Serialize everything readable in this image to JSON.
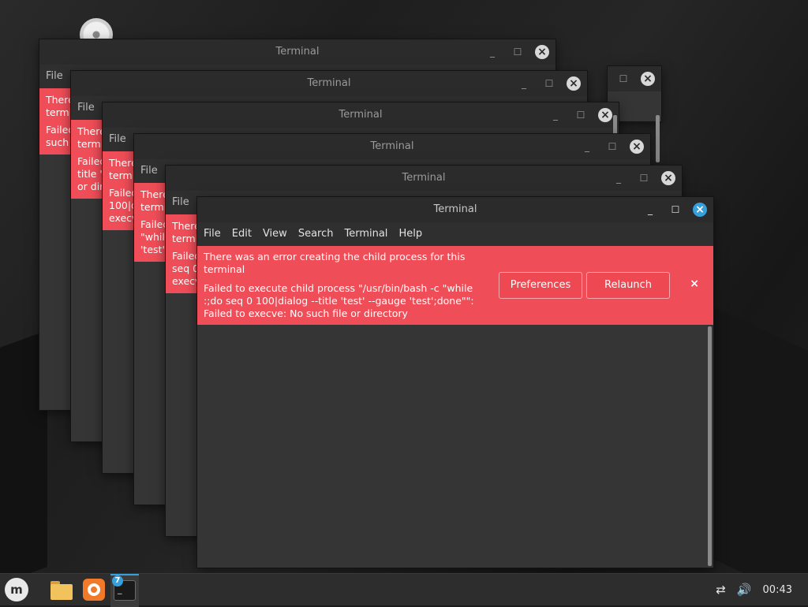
{
  "desktop": {
    "windows_back": [
      {
        "title": "Terminal",
        "menu_file": "File",
        "peek_lines": [
          "There",
          "termi",
          "Failed",
          "such"
        ]
      },
      {
        "title": "Terminal",
        "menu_file": "File",
        "peek_lines": [
          "There",
          "termi",
          "Failed",
          "title 't",
          "or dir"
        ]
      },
      {
        "title": "Terminal",
        "menu_file": "File",
        "peek_lines": [
          "There",
          "termi",
          "Failed",
          "100|d",
          "execve"
        ]
      },
      {
        "title": "Terminal",
        "menu_file": "File",
        "peek_lines": [
          "There",
          "termi",
          "Failed",
          "\"while",
          "'test';"
        ]
      },
      {
        "title": "Terminal",
        "menu_file": "File",
        "peek_lines": [
          "There",
          "termi",
          "Failed",
          "seq 0",
          "execv"
        ]
      }
    ],
    "active_window": {
      "title": "Terminal",
      "menu": [
        "File",
        "Edit",
        "View",
        "Search",
        "Terminal",
        "Help"
      ],
      "error": {
        "heading": "There was an error creating the child process for this terminal",
        "detail": "Failed to execute child process \"/usr/bin/bash -c \"while :;do seq 0 100|dialog --title 'test' --gauge 'test';done\"\": Failed to execve: No such file or directory",
        "preferences_label": "Preferences",
        "relaunch_label": "Relaunch",
        "dismiss_icon": "×"
      }
    }
  },
  "taskbar": {
    "menu_icon": "linux-mint-logo",
    "launchers": [
      "files-icon",
      "firefox-icon"
    ],
    "terminal_window_count": "7",
    "terminal_glyph": "_",
    "tray": {
      "network_icon": "network-disconnected-icon",
      "volume_icon": "volume-icon",
      "clock": "00:43"
    }
  },
  "colors": {
    "error_red": "#ef4d57",
    "accent_blue": "#35a0db",
    "window_bg": "#353535"
  }
}
